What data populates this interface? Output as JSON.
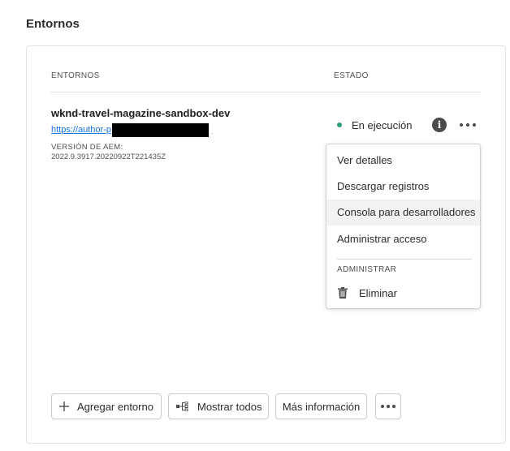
{
  "section": {
    "title": "Entornos"
  },
  "table": {
    "col_environments": "ENTORNOS",
    "col_status": "ESTADO"
  },
  "environment": {
    "name": "wknd-travel-magazine-sandbox-dev",
    "url_visible": "https://author-p",
    "url_suffix": ".",
    "aem_version_label": "VERSIÓN DE AEM:",
    "aem_version": "2022.9.3917.20220922T221435Z",
    "status": "En ejecución",
    "status_color": "#2d9d78"
  },
  "menu": {
    "items": [
      {
        "label": "Ver detalles"
      },
      {
        "label": "Descargar registros"
      },
      {
        "label": "Consola para desarrolladores"
      },
      {
        "label": "Administrar acceso"
      }
    ],
    "section_label": "ADMINISTRAR",
    "delete_label": "Eliminar"
  },
  "footer": {
    "add_label": "Agregar entorno",
    "show_all_label": "Mostrar todos",
    "more_info_label": "Más información"
  },
  "icons": {
    "status": "status-dot-icon",
    "info": "info-icon",
    "more": "more-icon",
    "trash": "trash-icon",
    "add": "add-icon",
    "show_all": "tree-view-icon"
  }
}
